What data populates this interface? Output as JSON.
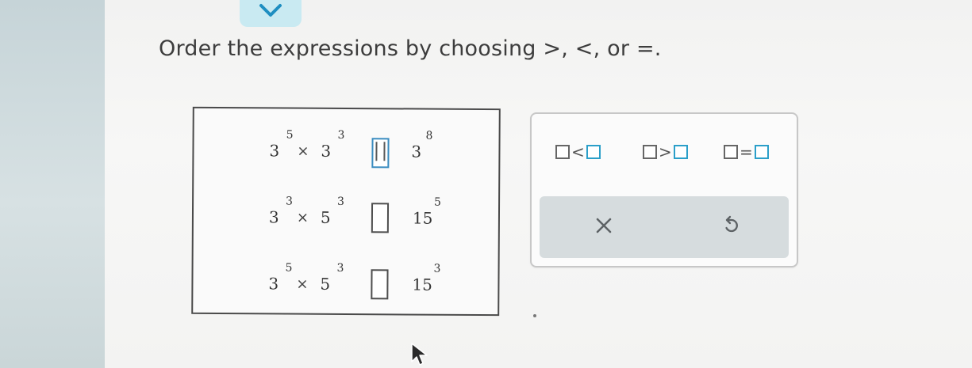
{
  "question": {
    "prompt": "Order the expressions by choosing >, <, or =."
  },
  "expressions": [
    {
      "left_base": "3",
      "left_exp": "5",
      "operator": "×",
      "right_base": "3",
      "right_exp": "3",
      "answer": "",
      "target_base": "3",
      "target_exp": "8"
    },
    {
      "left_base": "3",
      "left_exp": "3",
      "operator": "×",
      "right_base": "5",
      "right_exp": "3",
      "answer": "",
      "target_base": "15",
      "target_exp": "5"
    },
    {
      "left_base": "3",
      "left_exp": "5",
      "operator": "×",
      "right_base": "5",
      "right_exp": "3",
      "answer": "",
      "target_base": "15",
      "target_exp": "3"
    }
  ],
  "palette": {
    "less_symbol": "<",
    "greater_symbol": ">",
    "equal_symbol": "="
  },
  "icons": {
    "toggle": "chevron-down-icon",
    "clear": "close-icon",
    "undo": "undo-icon",
    "cursor": "mouse-pointer-icon"
  },
  "colors": {
    "toggle_bg": "#c9eaf2",
    "toggle_icon": "#1e8ec1",
    "slot_blue": "#2b9fc9"
  }
}
